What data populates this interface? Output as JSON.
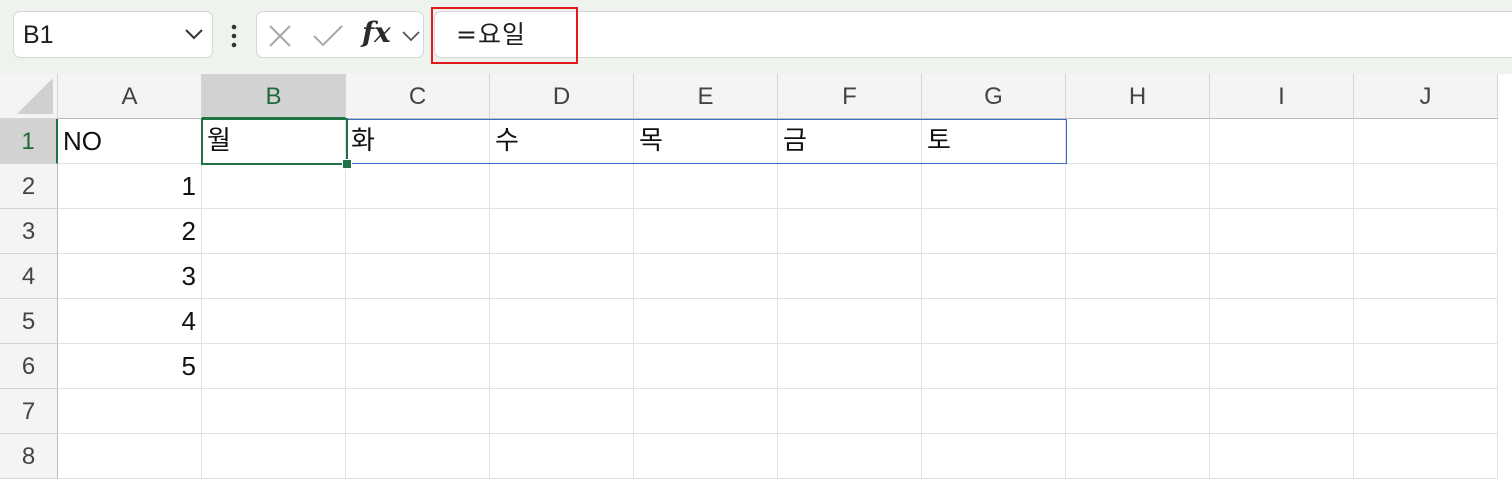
{
  "formula_bar": {
    "name_box": "B1",
    "fx_label": "fx",
    "formula": "=요일"
  },
  "columns": [
    "A",
    "B",
    "C",
    "D",
    "E",
    "F",
    "G",
    "H",
    "I",
    "J"
  ],
  "rows": [
    "1",
    "2",
    "3",
    "4",
    "5",
    "6",
    "7",
    "8"
  ],
  "cells": {
    "A1": "NO",
    "B1": "월",
    "C1": "화",
    "D1": "수",
    "E1": "목",
    "F1": "금",
    "G1": "토",
    "A2": "1",
    "A3": "2",
    "A4": "3",
    "A5": "4",
    "A6": "5"
  },
  "selection": {
    "active_cell": "B1",
    "active_column": "B",
    "active_row": "1"
  },
  "colors": {
    "accent": "#217346",
    "highlight": "#e01b1b",
    "spill": "#3b6fc4"
  }
}
